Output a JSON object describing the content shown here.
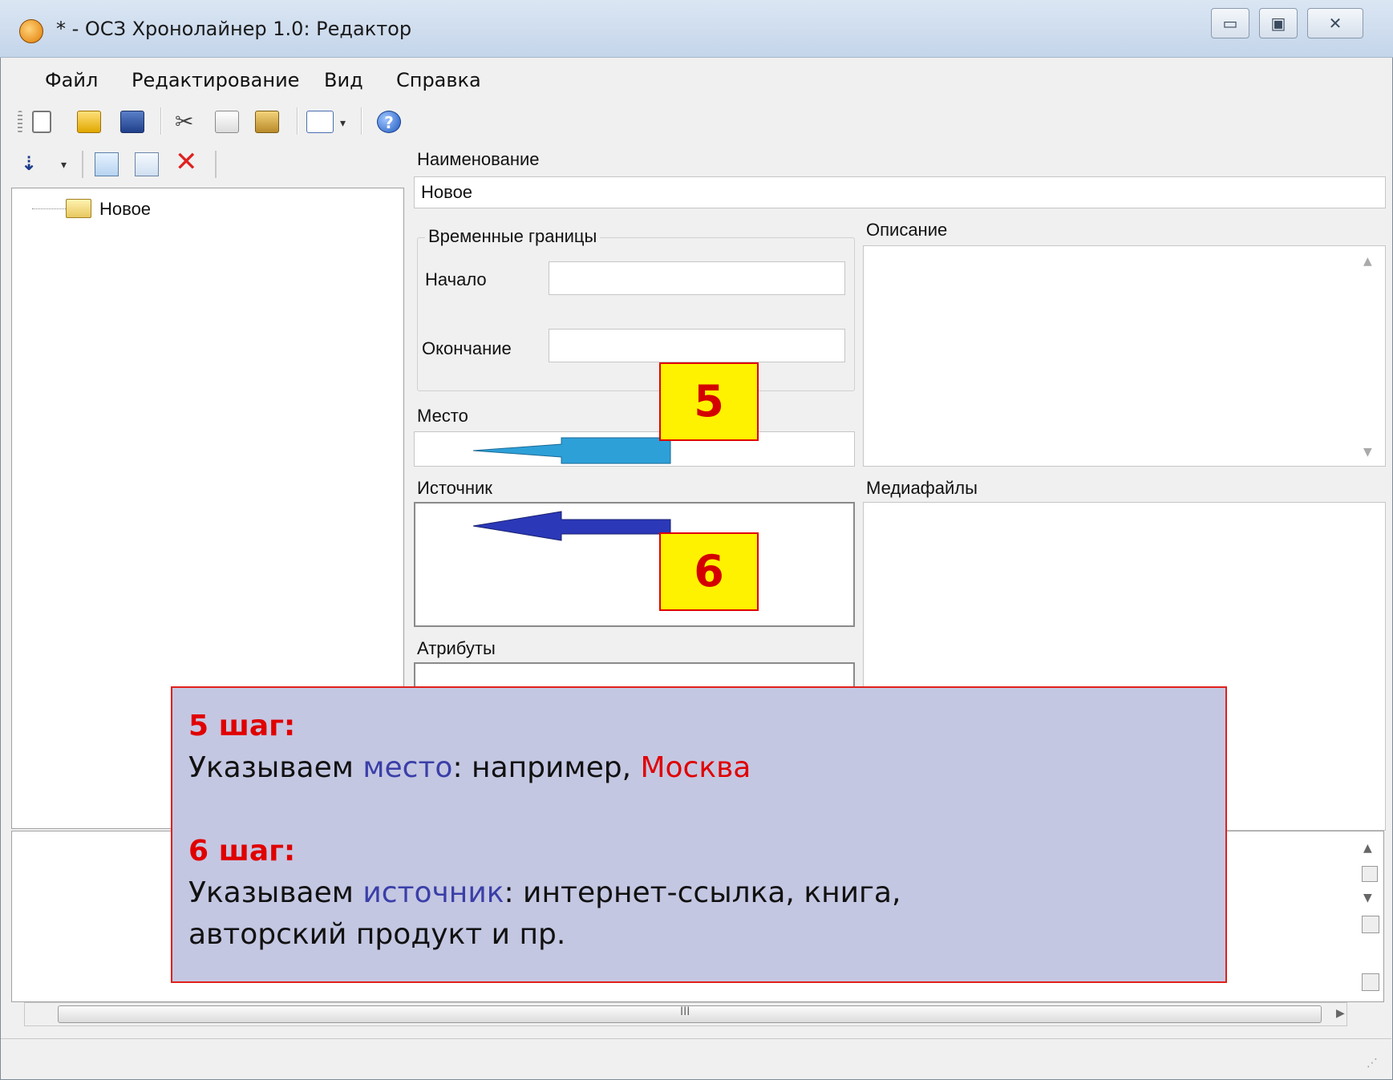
{
  "window": {
    "title": "* - ОСЗ Хронолайнер 1.0: Редактор",
    "controls": [
      "minimize",
      "maximize",
      "close"
    ]
  },
  "menu": [
    "Файл",
    "Редактирование",
    "Вид",
    "Справка"
  ],
  "toolbar": {
    "icons": [
      "new-file-icon",
      "open-folder-icon",
      "save-icon",
      "cut-icon",
      "copy-icon",
      "paste-icon",
      "grid-view-icon",
      "dropdown-icon",
      "help-icon"
    ]
  },
  "left_toolbar": {
    "icons": [
      "sort-icon",
      "dropdown-icon",
      "add-item-icon",
      "edit-item-icon",
      "delete-icon"
    ]
  },
  "tree": {
    "items": [
      {
        "label": "Новое",
        "icon": "folder-icon"
      }
    ]
  },
  "form": {
    "name_label": "Наименование",
    "name_value": "Новое",
    "time_group_label": "Временные границы",
    "start_label": "Начало",
    "end_label": "Окончание",
    "place_label": "Место",
    "description_label": "Описание",
    "source_label": "Источник",
    "media_label": "Медиафайлы",
    "attributes_label": "Атрибуты"
  },
  "callouts": {
    "five": "5",
    "six": "6",
    "arrow_place_color": "#2ea0d8",
    "arrow_source_color": "#2b38b8"
  },
  "info": {
    "step5_head": "5 шаг:",
    "step5_pre": "Указываем ",
    "step5_hl": "место",
    "step5_mid": ": например, ",
    "step5_example": "Москва",
    "step6_head": "6 шаг:",
    "step6_pre": "Указываем ",
    "step6_hl": "источник",
    "step6_line1_rest": ": интернет-ссылка, книга,",
    "step6_line2": "авторский продукт и пр."
  },
  "scrollbar": {
    "thumb_label": "III"
  }
}
